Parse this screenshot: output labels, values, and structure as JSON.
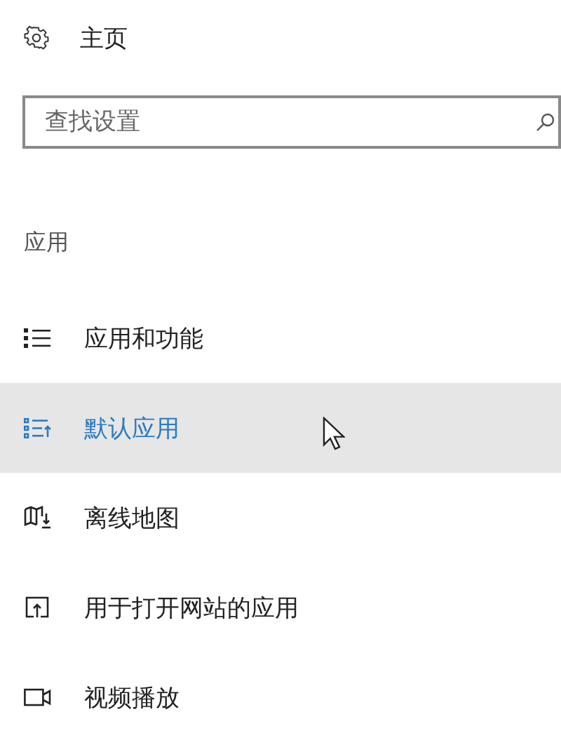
{
  "home": {
    "label": "主页"
  },
  "search": {
    "placeholder": "查找设置"
  },
  "section": {
    "title": "应用"
  },
  "nav_items": [
    {
      "label": "应用和功能",
      "selected": false
    },
    {
      "label": "默认应用",
      "selected": true
    },
    {
      "label": "离线地图",
      "selected": false
    },
    {
      "label": "用于打开网站的应用",
      "selected": false
    },
    {
      "label": "视频播放",
      "selected": false
    }
  ]
}
